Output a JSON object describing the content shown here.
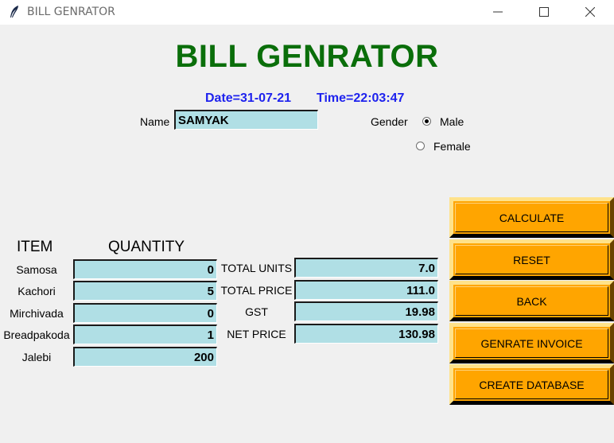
{
  "window": {
    "title": "BILL GENRATOR"
  },
  "header": {
    "title": "BILL GENRATOR",
    "date": "Date=31-07-21",
    "time": "Time=22:03:47"
  },
  "customer": {
    "name_label": "Name",
    "name_value": "SAMYAK",
    "gender_label": "Gender",
    "gender_options": [
      "Male",
      "Female"
    ],
    "gender_selected": "Male"
  },
  "items": {
    "item_header": "ITEM",
    "quantity_header": "QUANTITY",
    "rows": [
      {
        "name": "Samosa",
        "quantity": "0"
      },
      {
        "name": "Kachori",
        "quantity": "5"
      },
      {
        "name": "Mirchivada",
        "quantity": "0"
      },
      {
        "name": "Breadpakoda",
        "quantity": "1"
      },
      {
        "name": "Jalebi",
        "quantity": "200"
      }
    ]
  },
  "totals": [
    {
      "label": "TOTAL UNITS",
      "value": "7.0"
    },
    {
      "label": "TOTAL PRICE",
      "value": "111.0"
    },
    {
      "label": "GST",
      "value": "19.98"
    },
    {
      "label": "NET PRICE",
      "value": "130.98"
    }
  ],
  "actions": {
    "calculate": "CALCULATE",
    "reset": "RESET",
    "back": "BACK",
    "generate_invoice": "GENRATE INVOICE",
    "create_database": "CREATE DATABASE"
  },
  "colors": {
    "title_green": "#0a6e0a",
    "datetime_blue": "#1e22ee",
    "entry_bg": "#b0dfe5",
    "button_orange": "#ffa500"
  },
  "icons": [
    "feather-icon",
    "minimize-icon",
    "maximize-icon",
    "close-icon"
  ]
}
